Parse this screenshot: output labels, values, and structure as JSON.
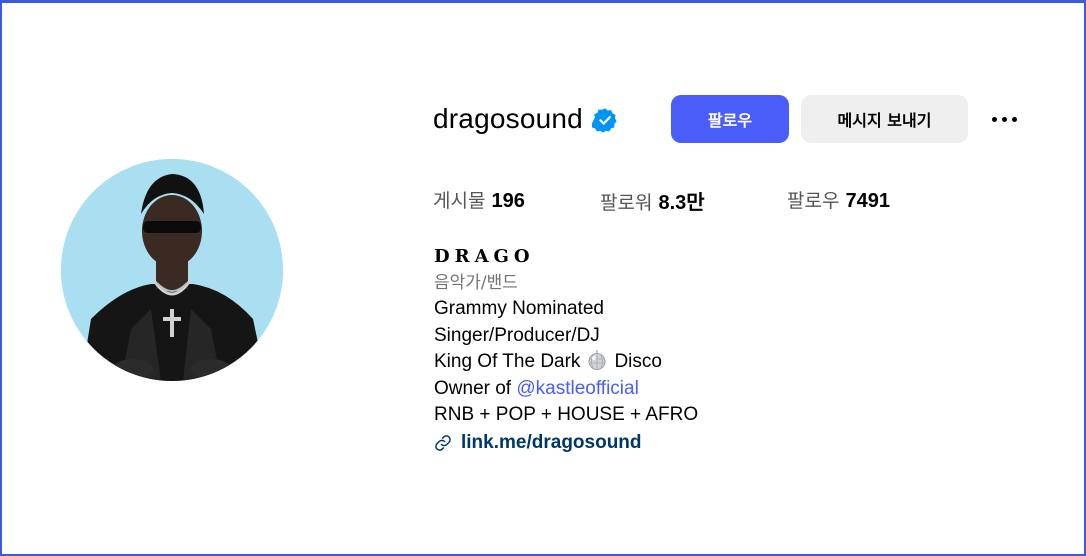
{
  "profile": {
    "username": "dragosound",
    "verified": true,
    "follow_label": "팔로우",
    "message_label": "메시지 보내기",
    "more_icon": "more-horizontal-icon"
  },
  "stats": {
    "posts_label": "게시물",
    "posts_value": "196",
    "followers_label": "팔로워",
    "followers_value": "8.3만",
    "following_label": "팔로우",
    "following_value": "7491"
  },
  "bio": {
    "display_name": "𝐃𝐑𝐀𝐆𝐎",
    "category": "음악가/밴드",
    "line1": "Grammy Nominated",
    "line2": "Singer/Producer/DJ",
    "line3_before": "King Of The Dark",
    "line3_emoji": "mirror-ball-icon",
    "line3_after": "Disco",
    "line4_before": "Owner of ",
    "line4_mention": "@kastleofficial",
    "line5": "RNB + POP + HOUSE + AFRO",
    "link": "link.me/dragosound"
  },
  "colors": {
    "accent": "#4a5df9",
    "verified": "#0095f6",
    "link": "#00376b",
    "frame": "#3b5bdb"
  }
}
